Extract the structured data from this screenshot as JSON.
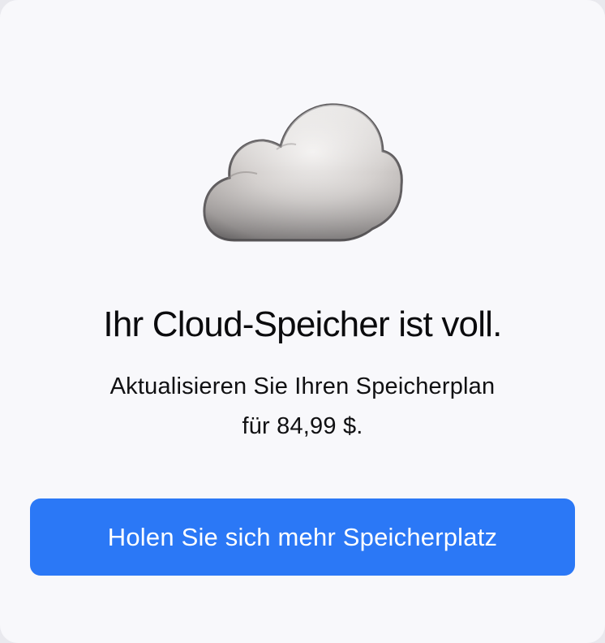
{
  "dialog": {
    "icon": "cloud-icon",
    "title": "Ihr Cloud-Speicher ist voll.",
    "subtitle_line1": "Aktualisieren Sie Ihren Speicherplan",
    "subtitle_line2": "für 84,99 $.",
    "cta_label": "Holen Sie sich mehr Speicherplatz"
  },
  "colors": {
    "background": "#f8f8fb",
    "accent": "#2b78f6",
    "text": "#0b0b0d",
    "button_text": "#ffffff"
  }
}
